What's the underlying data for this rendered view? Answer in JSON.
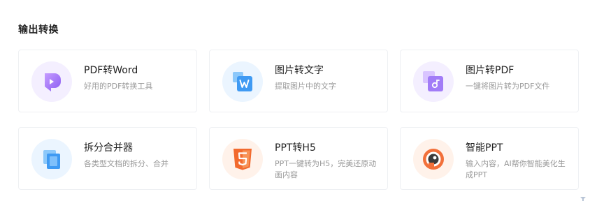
{
  "section": {
    "title": "输出转换"
  },
  "cards": [
    {
      "title": "PDF转Word",
      "desc": "好用的PDF转换工具",
      "icon": "pdf-to-word-icon",
      "bg": "#f4efff",
      "accent": "#9b6cf5"
    },
    {
      "title": "图片转文字",
      "desc": "提取图片中的文字",
      "icon": "image-to-text-icon",
      "bg": "#ebf5ff",
      "accent": "#4aa3f5"
    },
    {
      "title": "图片转PDF",
      "desc": "一键将图片转为PDF文件",
      "icon": "image-to-pdf-icon",
      "bg": "#f4efff",
      "accent": "#a07af7"
    },
    {
      "title": "拆分合并器",
      "desc": "各类型文档的拆分、合并",
      "icon": "split-merge-icon",
      "bg": "#ebf5ff",
      "accent": "#4a9ef5"
    },
    {
      "title": "PPT转H5",
      "desc": "PPT一键转为H5，完美还原动画内容",
      "icon": "html5-icon",
      "bg": "#fff2ea",
      "accent": "#f57a3a"
    },
    {
      "title": "智能PPT",
      "desc": "输入内容，AI帮你智能美化生成PPT",
      "icon": "smart-ppt-icon",
      "bg": "#fff2ea",
      "accent": "#f2703a"
    }
  ]
}
